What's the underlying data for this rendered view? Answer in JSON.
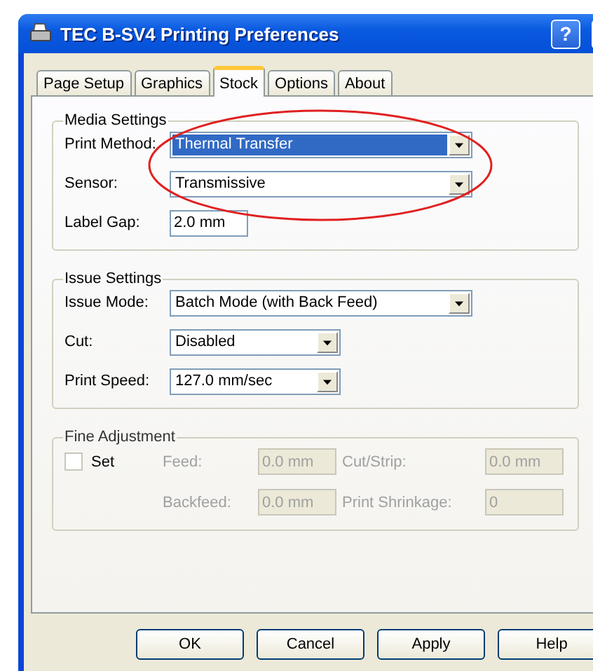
{
  "window": {
    "title": "TEC B-SV4 Printing Preferences"
  },
  "tabs": [
    {
      "label": "Page Setup",
      "selected": false
    },
    {
      "label": "Graphics",
      "selected": false
    },
    {
      "label": "Stock",
      "selected": true
    },
    {
      "label": "Options",
      "selected": false
    },
    {
      "label": "About",
      "selected": false
    }
  ],
  "groups": [
    {
      "title": "Media Settings",
      "disabled": false,
      "rows": [
        {
          "kind": "dropdown",
          "label": "Print Method:",
          "value": "Thermal Transfer",
          "focused": true
        },
        {
          "kind": "dropdown",
          "label": "Sensor:",
          "value": "Transmissive",
          "focused": false
        },
        {
          "kind": "input",
          "label": "Label Gap:",
          "value": "2.0 mm"
        }
      ]
    },
    {
      "title": "Issue Settings",
      "disabled": false,
      "rows": [
        {
          "kind": "dropdown",
          "label": "Issue Mode:",
          "value": "Batch Mode (with Back Feed)",
          "focused": false
        },
        {
          "kind": "short-dropdown",
          "label": "Cut:",
          "value": "Disabled",
          "focused": false
        },
        {
          "kind": "short-dropdown",
          "label": "Print Speed:",
          "value": "127.0 mm/sec",
          "focused": false
        }
      ]
    }
  ],
  "fine_adjustment": {
    "title": "Fine Adjustment",
    "set": {
      "label": "Set",
      "checked": false
    },
    "disabled": true,
    "fields": [
      {
        "label": "Feed:",
        "value": "0.0 mm"
      },
      {
        "label": "Cut/Strip:",
        "value": "0.0 mm"
      },
      {
        "label": "Backfeed:",
        "value": "0.0 mm"
      },
      {
        "label": "Print Shrinkage:",
        "value": "0"
      }
    ]
  },
  "buttons": [
    "OK",
    "Cancel",
    "Apply",
    "Help"
  ],
  "title_buttons": [
    "?"
  ],
  "highlight_ellipse": true
}
